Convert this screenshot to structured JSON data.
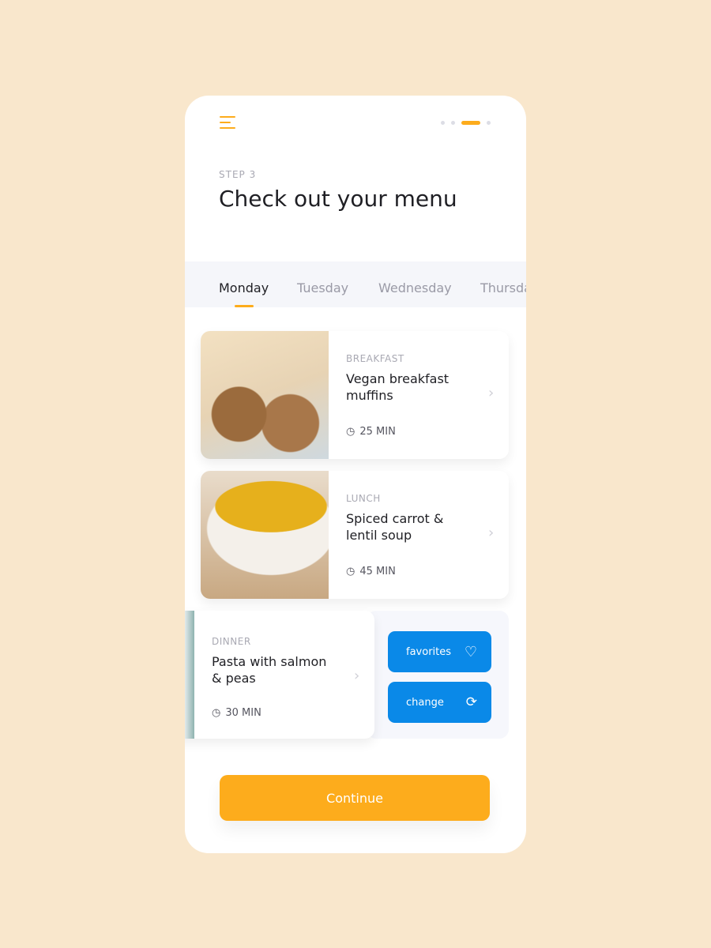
{
  "header": {
    "menu_icon": "hamburger-icon",
    "progress": {
      "steps": 4,
      "current": 3
    }
  },
  "step_label": "STEP 3",
  "title": "Check out your menu",
  "tabs": [
    {
      "label": "Monday",
      "active": true
    },
    {
      "label": "Tuesday"
    },
    {
      "label": "Wednesday"
    },
    {
      "label": "Thursday"
    }
  ],
  "meals": [
    {
      "type": "BREAKFAST",
      "name": "Vegan breakfast muffins",
      "time": "25 MIN"
    },
    {
      "type": "LUNCH",
      "name": "Spiced carrot & lentil soup",
      "time": "45 MIN"
    },
    {
      "type": "DINNER",
      "name": "Pasta with salmon & peas",
      "time": "30 MIN"
    }
  ],
  "actions": {
    "favorites": "favorites",
    "change": "change"
  },
  "continue_label": "Continue",
  "colors": {
    "accent": "#fdac1c",
    "action_blue": "#0a89e8",
    "background": "#f9e7cc"
  }
}
